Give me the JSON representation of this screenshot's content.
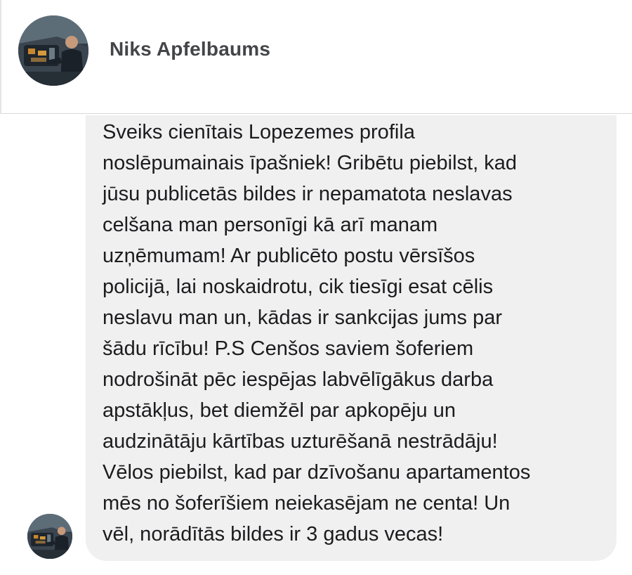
{
  "conversation": {
    "sender_name": "Niks Apfelbaums",
    "avatar_icon": "profile-photo-car-engine",
    "message_lines": [
      "Sveiks cienītais Lopezemes profila",
      "noslēpumainais īpašniek! Gribētu piebilst, kad",
      "jūsu publicetās bildes ir nepamatota neslavas",
      "celšana man personīgi kā arī manam",
      "uzņēmumam! Ar publicēto postu vērsīšos",
      "policijā, lai noskaidrotu, cik tiesīgi esat cēlis",
      "neslavu man un, kādas ir sankcijas jums par",
      "šādu rīcību! P.S Cenšos saviem šoferiem",
      "nodrošināt pēc iespējas labvēlīgākus darba",
      "apstākļus, bet diemžēl par apkopēju un",
      "audzinātāju kārtības uzturēšanā nestrādāju!",
      "Vēlos piebilst, kad par dzīvošanu apartamentos",
      "mēs no šoferīšiem neiekasējam ne centa! Un",
      "vēl, norādītās bildes ir 3 gadus vecas!"
    ]
  },
  "colors": {
    "bubble_background": "#f0f0f1",
    "message_text": "#1c1c1e",
    "name_text": "#444548",
    "divider": "#d9d9dc"
  }
}
